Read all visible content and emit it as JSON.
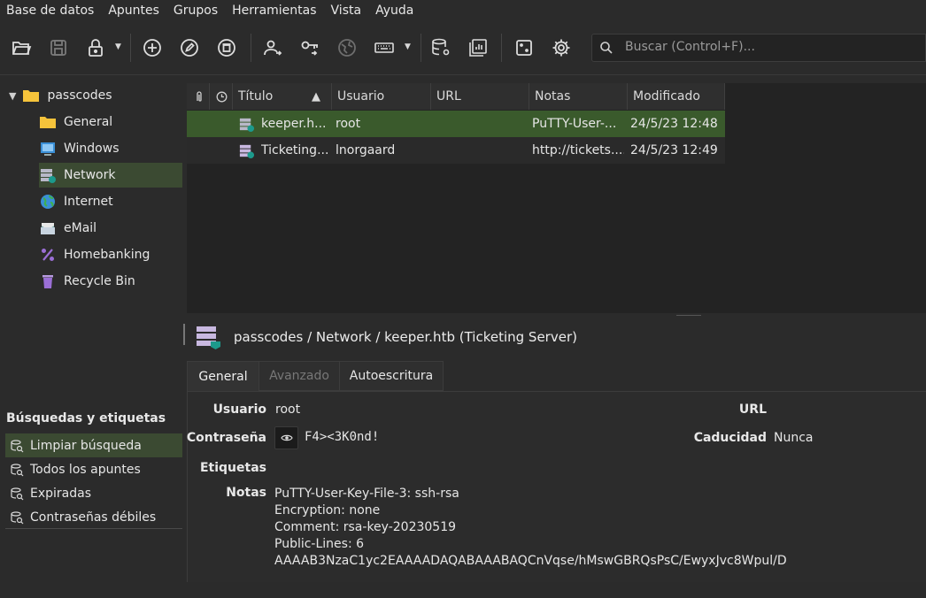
{
  "menu": [
    "Base de datos",
    "Apuntes",
    "Grupos",
    "Herramientas",
    "Vista",
    "Ayuda"
  ],
  "search": {
    "placeholder": "Buscar (Control+F)..."
  },
  "tree": {
    "root": "passcodes",
    "groups": [
      {
        "label": "General",
        "icon": "folder-icon"
      },
      {
        "label": "Windows",
        "icon": "windows-icon"
      },
      {
        "label": "Network",
        "icon": "server-icon",
        "selected": true
      },
      {
        "label": "Internet",
        "icon": "globe-icon"
      },
      {
        "label": "eMail",
        "icon": "mail-icon"
      },
      {
        "label": "Homebanking",
        "icon": "percent-icon"
      },
      {
        "label": "Recycle Bin",
        "icon": "trash-icon"
      }
    ]
  },
  "table": {
    "headers": {
      "title": "Título",
      "sort_indicator": "▲",
      "user": "Usuario",
      "url": "URL",
      "notes": "Notas",
      "modified": "Modificado"
    },
    "rows": [
      {
        "title": "keeper.h...",
        "user": "root",
        "url": "",
        "notes": "PuTTY-User-...",
        "modified": "24/5/23 12:48",
        "selected": true
      },
      {
        "title": "Ticketing...",
        "user": "lnorgaard",
        "url": "",
        "notes": "http://tickets....",
        "modified": "24/5/23 12:49",
        "selected": false
      }
    ]
  },
  "details": {
    "path": "passcodes / Network / keeper.htb (Ticketing Server)",
    "tabs": [
      {
        "label": "General",
        "state": "active"
      },
      {
        "label": "Avanzado",
        "state": "disabled"
      },
      {
        "label": "Autoescritura",
        "state": "normal"
      }
    ],
    "labels": {
      "user": "Usuario",
      "password": "Contraseña",
      "tags": "Etiquetas",
      "notes": "Notas",
      "url": "URL",
      "expiry": "Caducidad"
    },
    "user": "root",
    "password": "F4><3K0nd!",
    "url": "",
    "expiry": "Nunca",
    "notes": [
      "PuTTY-User-Key-File-3: ssh-rsa",
      "Encryption: none",
      "Comment: rsa-key-20230519",
      "Public-Lines: 6",
      "AAAAB3NzaC1yc2EAAAADAQABAAABAQCnVqse/hMswGBRQsPsC/EwyxJvc8Wpul/D"
    ]
  },
  "searches": {
    "title": "Búsquedas y etiquetas",
    "items": [
      "Limpiar búsqueda",
      "Todos los apuntes",
      "Expiradas",
      "Contraseñas débiles"
    ]
  },
  "colors": {
    "selection": "#3a5a2c",
    "sidebar_selection": "#3b4a32",
    "background": "#2b2b2b",
    "folder": "#f5c33b"
  }
}
